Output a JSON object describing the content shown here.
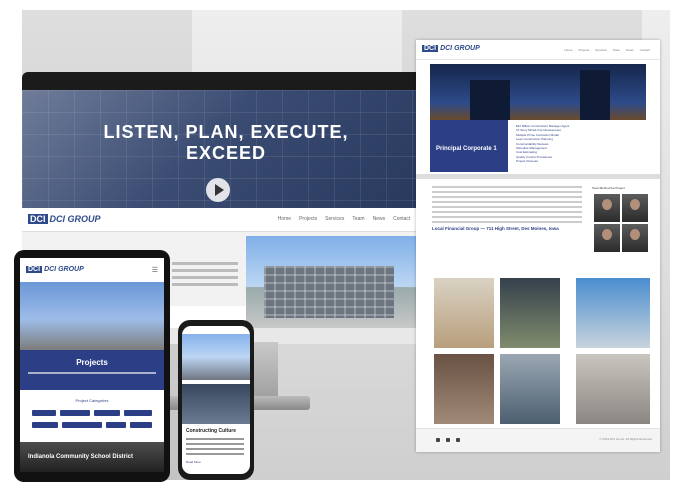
{
  "brand": {
    "name": "DCI GROUP",
    "mark": "DCI"
  },
  "desktop": {
    "hero_title_line1": "LISTEN, PLAN, EXECUTE,",
    "hero_title_line2": "EXCEED",
    "nav_links": [
      "Home",
      "Projects",
      "Services",
      "Team",
      "News",
      "Contact"
    ]
  },
  "project_page": {
    "nav_links": [
      "Home",
      "Projects",
      "Services",
      "Team",
      "News",
      "Contact"
    ],
    "banner_title": "Principal Corporate 1",
    "bullets": [
      "$42 Million Construction Manager Agent",
      "37-Story Mixed-Use Development",
      "Multiple Prime Contractor Model",
      "Lean Construction Planning",
      "Constructability Reviews",
      "Schedule Management",
      "Cost Estimating",
      "Quality Control Procedures",
      "Project Closeout"
    ],
    "project_heading": "Local Financial Group — 711 High Street, Des Moines, Iowa",
    "team_label": "Team Behind the Project",
    "footer_copy": "© 2019 DCI Group, All Rights Reserved"
  },
  "tablet": {
    "projects_title": "Projects",
    "categories_heading": "Project Categories",
    "footer_title": "Indianola Community School District"
  },
  "phone": {
    "section_title": "Constructing Culture",
    "link_text": "Read More"
  },
  "colors": {
    "brand_blue": "#2c3f86",
    "hero_overlay": "#3b4c73"
  }
}
